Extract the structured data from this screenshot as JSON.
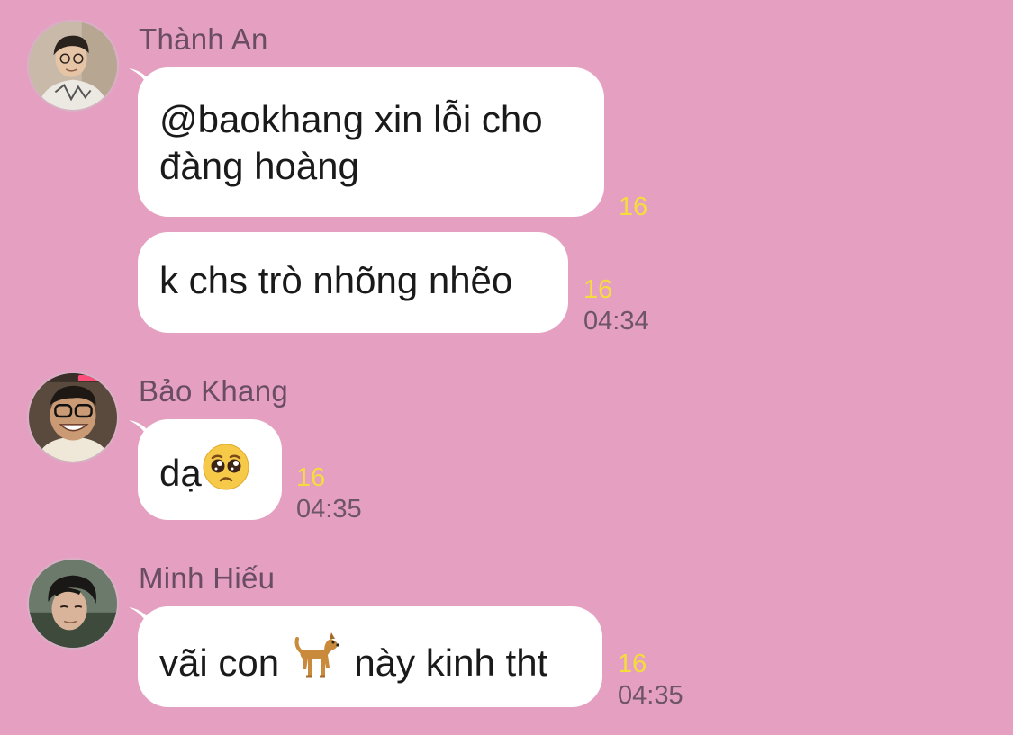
{
  "theme": {
    "background": "#e5a0c1",
    "bubble": "#ffffff",
    "read_count_color": "#f4dc3c",
    "time_color": "#6d5566",
    "sender_color": "#6a4d63"
  },
  "messages": [
    {
      "sender": "Thành An",
      "bubbles": [
        {
          "lines": [
            "@baokhang xin lỗi cho",
            "đàng hoàng"
          ],
          "read_count": "16",
          "time": ""
        },
        {
          "lines": [
            "k chs trò nhõng nhẽo"
          ],
          "read_count": "16",
          "time": "04:34"
        }
      ]
    },
    {
      "sender": "Bảo Khang",
      "bubbles": [
        {
          "text_before": "dạ",
          "emoji": "pleading-face-emoji",
          "read_count": "16",
          "time": "04:35"
        }
      ]
    },
    {
      "sender": "Minh Hiếu",
      "bubbles": [
        {
          "text_before": "vãi con",
          "emoji": "dog-emoji",
          "text_after": "này kinh tht",
          "read_count": "16",
          "time": "04:35"
        }
      ]
    }
  ]
}
